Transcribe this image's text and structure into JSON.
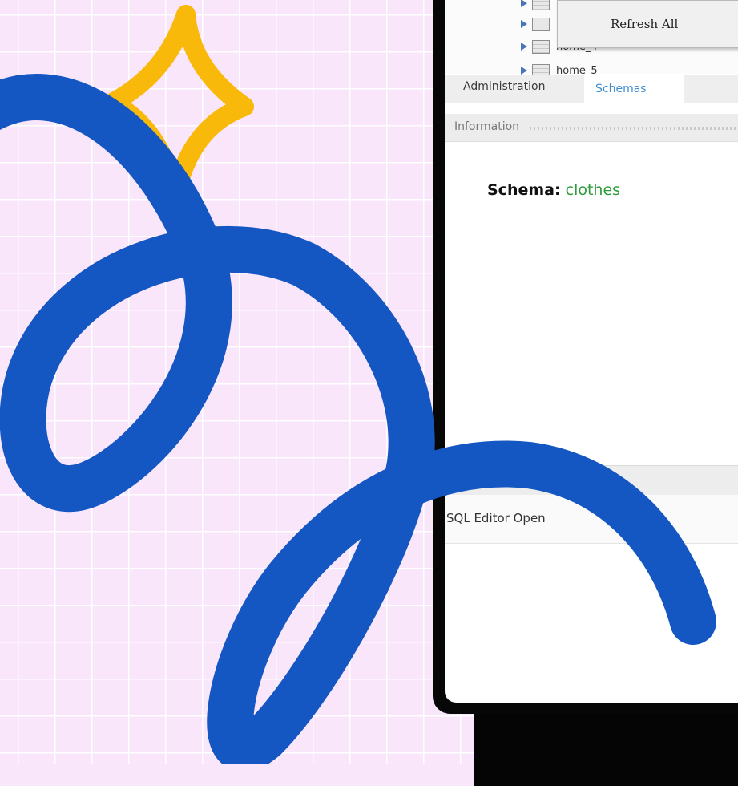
{
  "tree": {
    "items": [
      {
        "label": ""
      },
      {
        "label": ""
      },
      {
        "label": "home_4"
      },
      {
        "label": "home_5"
      }
    ]
  },
  "context_menu": {
    "items": [
      "Refresh All"
    ]
  },
  "tabs": [
    {
      "label": "Administration",
      "active": false
    },
    {
      "label": "Schemas",
      "active": true
    }
  ],
  "info_panel": {
    "title": "Information",
    "schema_label": "Schema:",
    "schema_value": "clothes"
  },
  "status": {
    "text": "SQL Editor Open"
  },
  "colors": {
    "background": "#f9e6fb",
    "squiggle": "#1456c2",
    "sparkle": "#f8b90a",
    "active_tab": "#3c8ed4",
    "schema_value": "#2e9c3a"
  },
  "icons": [
    "sparkle-icon",
    "squiggle-decoration",
    "table-icon",
    "expand-arrow-icon"
  ]
}
